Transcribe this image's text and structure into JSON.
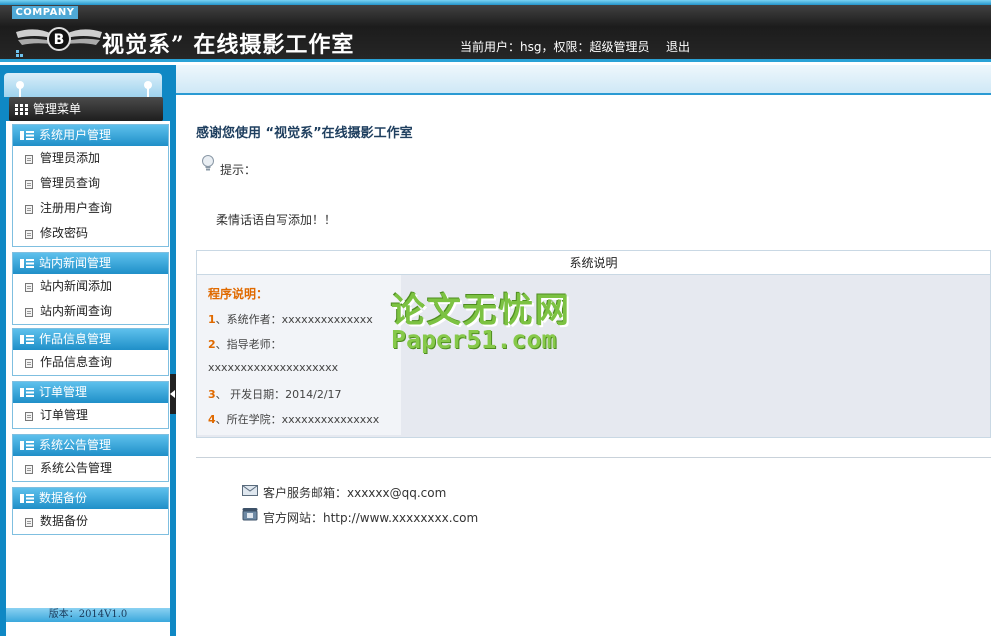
{
  "header": {
    "company": "COMPANY",
    "title": "视觉系” 在线摄影工作室",
    "user_info": "当前用户：hsg，权限：超级管理员",
    "logout": "退出"
  },
  "sidebar": {
    "menu_title": "管理菜单",
    "groups": [
      {
        "title": "系统用户管理",
        "items": [
          "管理员添加",
          "管理员查询",
          "注册用户查询",
          "修改密码"
        ]
      },
      {
        "title": "站内新闻管理",
        "items": [
          "站内新闻添加",
          "站内新闻查询"
        ]
      },
      {
        "title": "作品信息管理",
        "items": [
          "作品信息查询"
        ]
      },
      {
        "title": "订单管理",
        "items": [
          "订单管理"
        ]
      },
      {
        "title": "系统公告管理",
        "items": [
          "系统公告管理"
        ]
      },
      {
        "title": "数据备份",
        "items": [
          "数据备份"
        ]
      }
    ],
    "version": "版本：2014V1.0"
  },
  "main": {
    "welcome": "感谢您使用 “视觉系”在线摄影工作室",
    "tip_label": "提示：",
    "tip_text": "柔情话语自写添加！！",
    "table_header": "系统说明",
    "program_title": "程序说明：",
    "lines": [
      {
        "num": "1",
        "text": "、系统作者：xxxxxxxxxxxxxx"
      },
      {
        "num": "2",
        "text": "、指导老师："
      },
      {
        "num": "",
        "text": "xxxxxxxxxxxxxxxxxxxx"
      },
      {
        "num": "3",
        "text": "、 开发日期：2014/2/17"
      },
      {
        "num": "4",
        "text": "、所在学院：xxxxxxxxxxxxxxx"
      }
    ],
    "watermark_cn": "论文无忧网",
    "watermark_en": "Paper51.com",
    "email": "客户服务邮箱：xxxxxx@qq.com",
    "website": "官方网站：http://www.xxxxxxxx.com"
  },
  "colors": {
    "accent": "#1f8fc8",
    "header_bg": "#1c1c1c",
    "highlight": "#e06a00"
  }
}
